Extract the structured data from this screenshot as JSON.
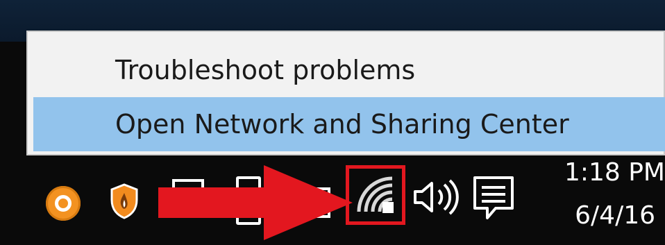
{
  "context_menu": {
    "items": [
      {
        "label": "Troubleshoot problems",
        "highlighted": false
      },
      {
        "label": "Open Network and Sharing Center",
        "highlighted": true
      }
    ],
    "highlight_color": "#92c3ec"
  },
  "taskbar": {
    "clock": {
      "time": "1:18 PM",
      "date": "6/4/16"
    },
    "tray_icons": [
      {
        "name": "orange-ring-icon",
        "color": "#f39221"
      },
      {
        "name": "shield-icon",
        "color": "#f28b1e"
      },
      {
        "name": "window-icon"
      },
      {
        "name": "device-icon"
      },
      {
        "name": "battery-icon"
      },
      {
        "name": "wifi-icon",
        "highlight": "#e3171f"
      },
      {
        "name": "speaker-icon"
      },
      {
        "name": "notification-icon"
      }
    ],
    "annotation_arrow_color": "#e3171f"
  }
}
